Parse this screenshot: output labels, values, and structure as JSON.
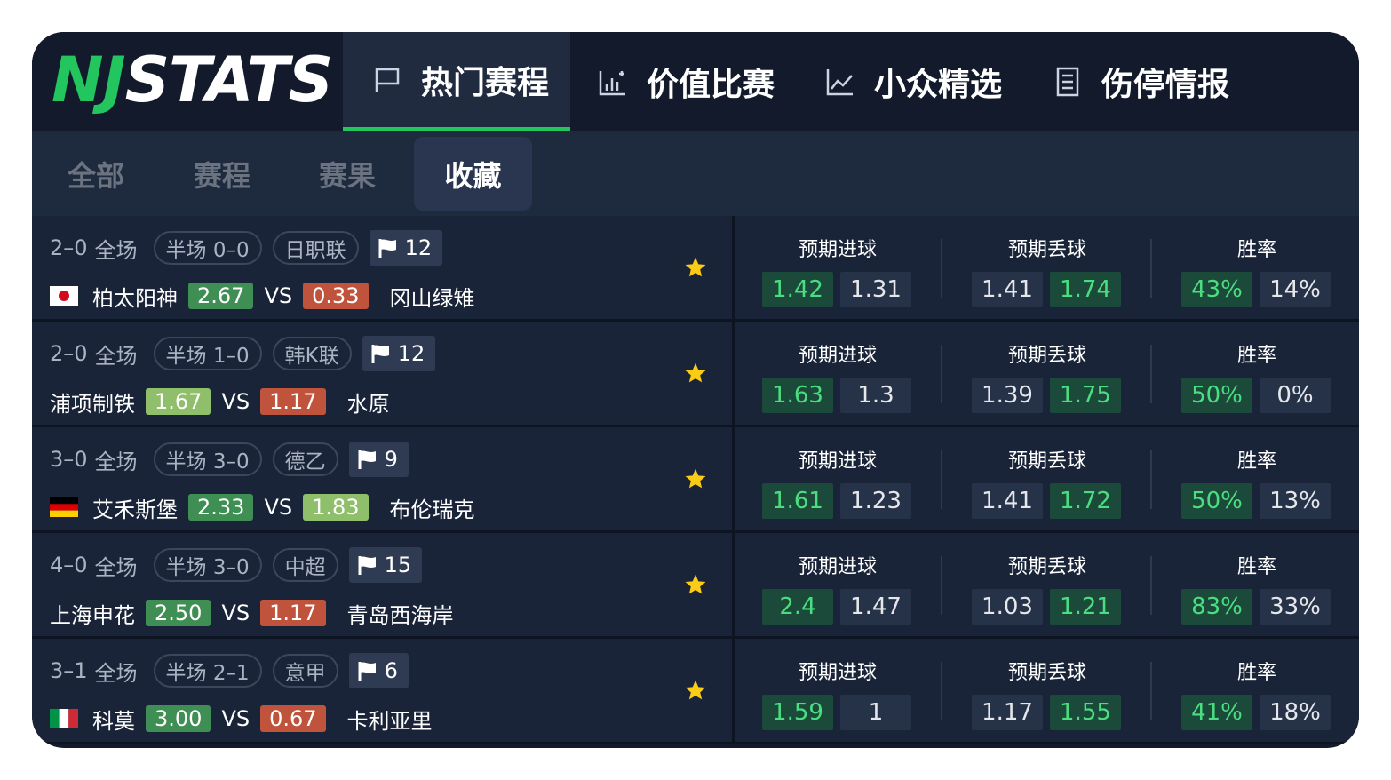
{
  "brand": {
    "nj": "NJ",
    "stats": "STATS"
  },
  "nav": [
    {
      "label": "热门赛程",
      "icon": "flag-icon",
      "active": true
    },
    {
      "label": "价值比赛",
      "icon": "bar-chart-icon",
      "active": false
    },
    {
      "label": "小众精选",
      "icon": "line-chart-icon",
      "active": false
    },
    {
      "label": "伤停情报",
      "icon": "document-icon",
      "active": false
    }
  ],
  "subtabs": [
    {
      "label": "全部",
      "active": false
    },
    {
      "label": "赛程",
      "active": false
    },
    {
      "label": "赛果",
      "active": false
    },
    {
      "label": "收藏",
      "active": true
    }
  ],
  "stat_labels": {
    "xg_for": "预期进球",
    "xg_against": "预期丢球",
    "win_rate": "胜率"
  },
  "vs_label": "VS",
  "colors": {
    "accent": "#22c55e",
    "odd_green": "#3f8f54",
    "odd_lightgreen": "#8fbf6b",
    "odd_red": "#c0533c",
    "star": "#facc15"
  },
  "matches": [
    {
      "score": "2–0",
      "full": "全场",
      "half": "半场 0–0",
      "league": "日职联",
      "corners": "12",
      "home_flag": "japan",
      "home": "柏太阳神",
      "home_odd": "2.67",
      "home_odd_color": "#3f8f54",
      "away": "冈山绿雉",
      "away_odd": "0.33",
      "away_odd_color": "#c0533c",
      "xg_for": [
        "1.42",
        "1.31"
      ],
      "xg_against": [
        "1.41",
        "1.74"
      ],
      "win_rate": [
        "43%",
        "14%"
      ]
    },
    {
      "score": "2–0",
      "full": "全场",
      "half": "半场 1–0",
      "league": "韩K联",
      "corners": "12",
      "home_flag": "",
      "home": "浦项制铁",
      "home_odd": "1.67",
      "home_odd_color": "#8fbf6b",
      "away": "水原",
      "away_odd": "1.17",
      "away_odd_color": "#c0533c",
      "xg_for": [
        "1.63",
        "1.3"
      ],
      "xg_against": [
        "1.39",
        "1.75"
      ],
      "win_rate": [
        "50%",
        "0%"
      ]
    },
    {
      "score": "3–0",
      "full": "全场",
      "half": "半场 3–0",
      "league": "德乙",
      "corners": "9",
      "home_flag": "germany",
      "home": "艾禾斯堡",
      "home_odd": "2.33",
      "home_odd_color": "#3f8f54",
      "away": "布伦瑞克",
      "away_odd": "1.83",
      "away_odd_color": "#8fbf6b",
      "xg_for": [
        "1.61",
        "1.23"
      ],
      "xg_against": [
        "1.41",
        "1.72"
      ],
      "win_rate": [
        "50%",
        "13%"
      ]
    },
    {
      "score": "4–0",
      "full": "全场",
      "half": "半场 3–0",
      "league": "中超",
      "corners": "15",
      "home_flag": "",
      "home": "上海申花",
      "home_odd": "2.50",
      "home_odd_color": "#3f8f54",
      "away": "青岛西海岸",
      "away_odd": "1.17",
      "away_odd_color": "#c0533c",
      "xg_for": [
        "2.4",
        "1.47"
      ],
      "xg_against": [
        "1.03",
        "1.21"
      ],
      "win_rate": [
        "83%",
        "33%"
      ]
    },
    {
      "score": "3–1",
      "full": "全场",
      "half": "半场 2–1",
      "league": "意甲",
      "corners": "6",
      "home_flag": "italy",
      "home": "科莫",
      "home_odd": "3.00",
      "home_odd_color": "#3f8f54",
      "away": "卡利亚里",
      "away_odd": "0.67",
      "away_odd_color": "#c0533c",
      "xg_for": [
        "1.59",
        "1"
      ],
      "xg_against": [
        "1.17",
        "1.55"
      ],
      "win_rate": [
        "41%",
        "18%"
      ]
    }
  ]
}
